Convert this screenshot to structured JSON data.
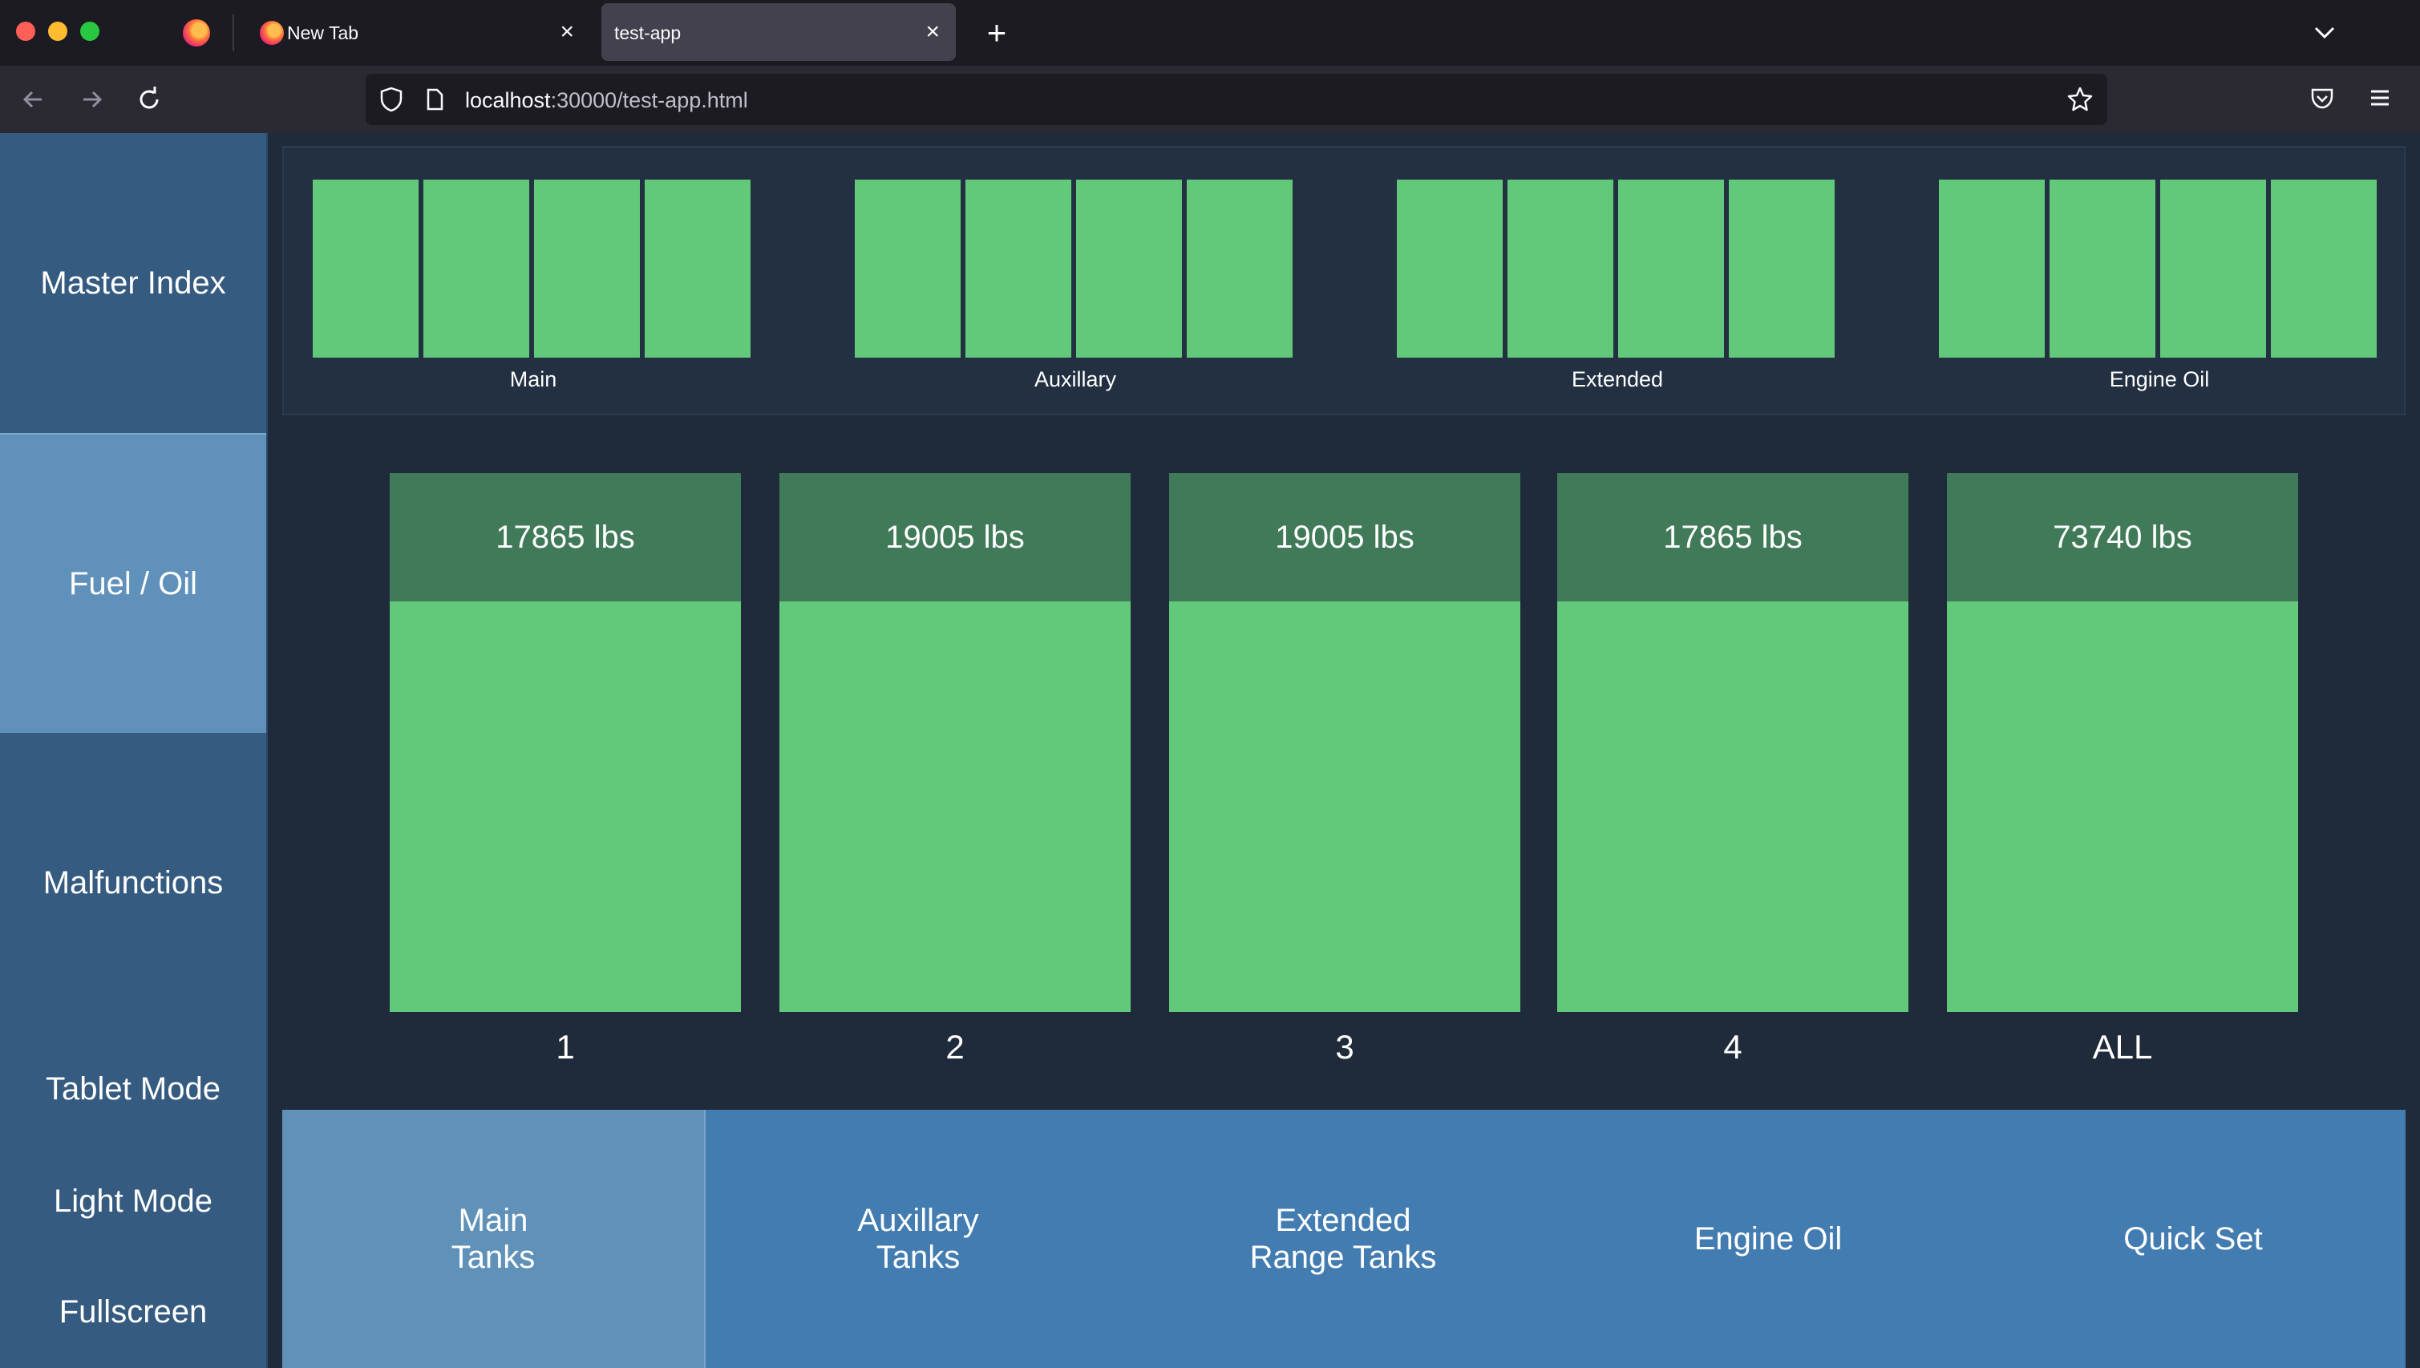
{
  "browser": {
    "tabs": [
      {
        "title": "New Tab",
        "active": false
      },
      {
        "title": "test-app",
        "active": true
      }
    ],
    "url": {
      "host": "localhost",
      "rest": ":30000/test-app.html"
    }
  },
  "sidebar": {
    "items": [
      {
        "label": "Master Index",
        "active": false
      },
      {
        "label": "Fuel / Oil",
        "active": true
      },
      {
        "label": "Malfunctions",
        "active": false
      },
      {
        "label": "Tablet Mode",
        "active": false
      },
      {
        "label": "Light Mode",
        "active": false
      },
      {
        "label": "Fullscreen",
        "active": false
      }
    ]
  },
  "overview": {
    "groups": [
      {
        "label": "Main",
        "cells": 4
      },
      {
        "label": "Auxillary",
        "cells": 4
      },
      {
        "label": "Extended",
        "cells": 4
      },
      {
        "label": "Engine Oil",
        "cells": 4
      }
    ]
  },
  "tanks": [
    {
      "label": "1",
      "value": "17865 lbs"
    },
    {
      "label": "2",
      "value": "19005 lbs"
    },
    {
      "label": "3",
      "value": "19005 lbs"
    },
    {
      "label": "4",
      "value": "17865 lbs"
    },
    {
      "label": "ALL",
      "value": "73740 lbs"
    }
  ],
  "bottom_tabs": [
    {
      "label": "Main\nTanks",
      "active": true
    },
    {
      "label": "Auxillary\nTanks",
      "active": false
    },
    {
      "label": "Extended\nRange Tanks",
      "active": false
    },
    {
      "label": "Engine Oil",
      "active": false
    },
    {
      "label": "Quick Set",
      "active": false
    }
  ],
  "colors": {
    "fuel_green": "#63c97a",
    "tank_header": "#407a59",
    "sidebar": "#365b80",
    "sidebar_active": "#5f91bb",
    "bottom_bar": "#427cb0",
    "bottom_active": "#6091b8"
  }
}
